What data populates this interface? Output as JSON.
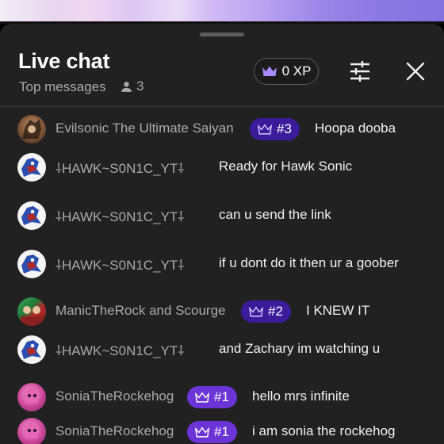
{
  "header": {
    "title": "Live chat",
    "subtitle": "Top messages",
    "viewer_count": "3",
    "xp_label": "0 XP"
  },
  "icons": {
    "person": "person-icon",
    "crown": "crown-icon",
    "filter": "tune-sliders-icon",
    "close": "close-icon"
  },
  "colors": {
    "sheet_bg": "#212121",
    "badge_rank3": "#3a1b9a",
    "badge_rank1": "#6a34d6",
    "author_text": "#aaaaaa",
    "accent_crown": "#a88bff"
  },
  "messages": [
    {
      "author": "Evilsonic The Ultimate Saiyan",
      "rank": "#3",
      "text": "Hoopa dooba",
      "avatar": "avatar-evilsonic"
    },
    {
      "author": "⸸HAWK~S0N1C_YT⸸",
      "rank": "",
      "text": "Ready for Hawk Sonic",
      "avatar": "avatar-hawk"
    },
    {
      "author": "⸸HAWK~S0N1C_YT⸸",
      "rank": "",
      "text": "can u send the link",
      "avatar": "avatar-hawk"
    },
    {
      "author": "⸸HAWK~S0N1C_YT⸸",
      "rank": "",
      "text": "if u dont do it then ur a goober",
      "avatar": "avatar-hawk"
    },
    {
      "author": "ManicTheRock and Scourge",
      "rank": "#2",
      "text": "I KNEW IT",
      "avatar": "avatar-manic"
    },
    {
      "author": "⸸HAWK~S0N1C_YT⸸",
      "rank": "",
      "text": "and Zachary im watching u",
      "avatar": "avatar-hawk"
    },
    {
      "author": "SoniaTheRockehog",
      "rank": "#1",
      "text": "hello mrs infinite",
      "avatar": "avatar-sonia"
    },
    {
      "author": "SoniaTheRockehog",
      "rank": "#1",
      "text": "i am sonia the rockehog",
      "avatar": "avatar-sonia"
    }
  ]
}
